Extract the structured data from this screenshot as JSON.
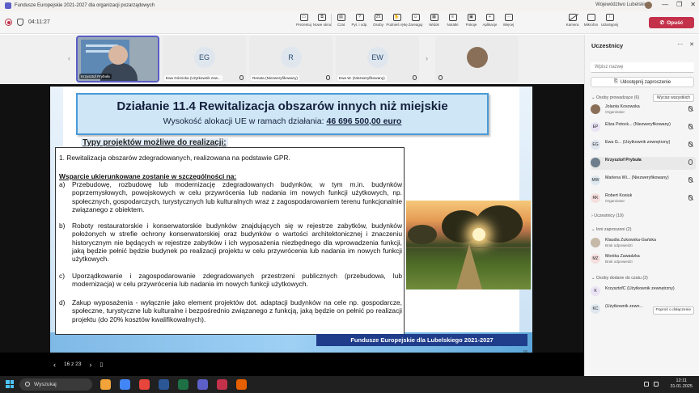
{
  "window": {
    "title": "Fundusze Europejskie 2021-2027 dla organizacji pozarządowych",
    "org_name": "Województwo Lubelskie",
    "controls": [
      "—",
      "❐",
      "✕"
    ]
  },
  "meeting": {
    "elapsed": "04:11:27",
    "tools": [
      {
        "label": "Prezentuj",
        "icon": "present-icon"
      },
      {
        "label": "Nowe okno",
        "icon": "new-window-icon"
      },
      {
        "label": "Czat",
        "icon": "chat-icon"
      },
      {
        "label": "Pyt. i odp.",
        "icon": "qa-icon"
      },
      {
        "label": "Osoby",
        "icon": "people-icon",
        "badge": "25"
      },
      {
        "label": "Podnieś rękę",
        "icon": "raise-hand-icon"
      },
      {
        "label": "Zareaguj",
        "icon": "react-icon"
      },
      {
        "label": "Widok",
        "icon": "view-icon"
      },
      {
        "label": "Notatki",
        "icon": "notes-icon"
      },
      {
        "label": "Pokoje",
        "icon": "rooms-icon"
      },
      {
        "label": "Aplikacje",
        "icon": "apps-icon"
      },
      {
        "label": "Więcej",
        "icon": "more-icon"
      }
    ],
    "device_tools": [
      {
        "label": "Kamera",
        "icon": "camera-off-icon"
      },
      {
        "label": "Mikrofon",
        "icon": "mic-icon"
      },
      {
        "label": "Udostępnij",
        "icon": "share-icon"
      }
    ],
    "leave_label": "Opuść"
  },
  "video_strip": [
    {
      "name": "Krzysztof Prybuła",
      "initials": "",
      "active": true
    },
    {
      "name": "Ewa Górnicka (Użytkownik zew...",
      "initials": "EG",
      "active": false
    },
    {
      "name": "Renata (Niezweryfikowany)",
      "initials": "R",
      "active": false
    },
    {
      "name": "Ewa W. (Niezweryfikowany)",
      "initials": "EW",
      "active": false
    },
    {
      "name": "",
      "initials": "",
      "active": false
    }
  ],
  "slide": {
    "title": "Działanie 11.4 Rewitalizacja obszarów innych niż miejskie",
    "subtitle_prefix": "Wysokość alokacji UE w ramach działania:",
    "allocation": "46 696 500,00 euro",
    "section": "Typy projektów możliwe do realizacji:",
    "point1": "1.   Rewitalizacja obszarów zdegradowanych, realizowana na podstawie GPR.",
    "support_heading": "Wsparcie ukierunkowane zostanie w szczególności na:",
    "items": [
      {
        "letter": "a)",
        "text": "Przebudowę, rozbudowę lub modernizację zdegradowanych budynków, w tym m.in. budynków poprzemysłowych, powojskowych w celu przywrócenia lub nadania im nowych funkcji użytkowych, np. społecznych, gospodarczych, turystycznych lub kulturalnych wraz z zagospodarowaniem terenu funkcjonalnie związanego z obiektem."
      },
      {
        "letter": "b)",
        "text": "Roboty restauratorskie i konserwatorskie budynków znajdujących się w rejestrze zabytków, budynków położonych w strefie ochrony konserwatorskiej oraz budynków o wartości architektonicznej i znaczeniu historycznym nie będących w rejestrze zabytków i ich wyposażenia niezbędnego dla wprowadzenia funkcji, jaką będzie pełnić będzie budynek po realizacji projektu w celu przywrócenia lub nadania im nowych funkcji użytkowych."
      },
      {
        "letter": "c)",
        "text": "Uporządkowanie i zagospodarowanie zdegradowanych przestrzeni publicznych (przebudowa, lub modernizacja) w celu przywrócenia lub nadania im nowych funkcji użytkowych."
      },
      {
        "letter": "d)",
        "text": "Zakup wyposażenia - wyłącznie jako element projektów dot. adaptacji budynków na cele np. gospodarcze, społeczne, turystyczne lub kulturalne i bezpośrednio związanego z funkcją, jaką będzie on pełnić po realizacji projektu (do 20% kosztów kwalifikowalnych)."
      }
    ],
    "footer": "Fundusze Europejskie dla Lubelskiego 2021-2027",
    "page_number": "16"
  },
  "viewer": {
    "prev": "‹",
    "pages": "16 z 23",
    "next": "›",
    "toggle": "▯"
  },
  "panel": {
    "title": "Uczestnicy",
    "search_placeholder": "Wpisz nazwę",
    "invite_label": "Udostępnij zaproszenie",
    "organizers_header": "Osoby prowadzące (6)",
    "mute_all": "Wycisz wszystkich",
    "organizers": [
      {
        "name": "Jolanta Kosowska",
        "role": "Organizator",
        "initials": "",
        "color": "#8a6f58",
        "muted": true
      },
      {
        "name": "Eliza Potock... (Niezweryfikowany)",
        "role": "",
        "initials": "EP",
        "color": "#e9e3f5",
        "muted": true
      },
      {
        "name": "Ewa G... (Użytkownik zewnętrzny)",
        "role": "",
        "initials": "EG",
        "color": "#dfe6ee",
        "muted": true
      },
      {
        "name": "Krzysztof Prybuła",
        "role": "",
        "initials": "",
        "color": "#6d7d8b",
        "muted": false,
        "speaker": true
      },
      {
        "name": "Marlena Wi... (Niezweryfikowany)",
        "role": "",
        "initials": "MW",
        "color": "#dde8ef",
        "muted": true
      },
      {
        "name": "Robert Kosiuk",
        "role": "Organizator",
        "initials": "RK",
        "color": "#f5dede",
        "muted": true
      }
    ],
    "attendees_header": "Uczestnicy (19)",
    "invited_header": "Inni zaproszeni (2)",
    "invited": [
      {
        "name": "Klaudia Żukowska-Gańska",
        "role": "Brak odpowiedzi",
        "initials": "",
        "color": "#c7b9a8"
      },
      {
        "name": "Monika Zawadzka",
        "role": "Brak odpowiedzi",
        "initials": "MZ",
        "color": "#f5dede"
      }
    ],
    "lobby_header": "Osoby dodane do czatu (2)",
    "lobby": [
      {
        "name": "KrzysztofC (Użytkownik zewnętrzny)",
        "initials": "K",
        "color": "#e9e3f5"
      },
      {
        "name": "(Użytkownik zewn...",
        "initials": "KC",
        "color": "#dfe6ee"
      }
    ],
    "admit_label": "Poproś o dołączenie"
  },
  "taskbar": {
    "search_label": "Wyszukaj",
    "time": "12:11",
    "date": "31.01.2025",
    "app_colors": [
      "#f2a33a",
      "#4285f4",
      "#e8453c",
      "#2b5797",
      "#1e7145",
      "#5b5fc7",
      "#c4314b",
      "#e66000"
    ]
  }
}
